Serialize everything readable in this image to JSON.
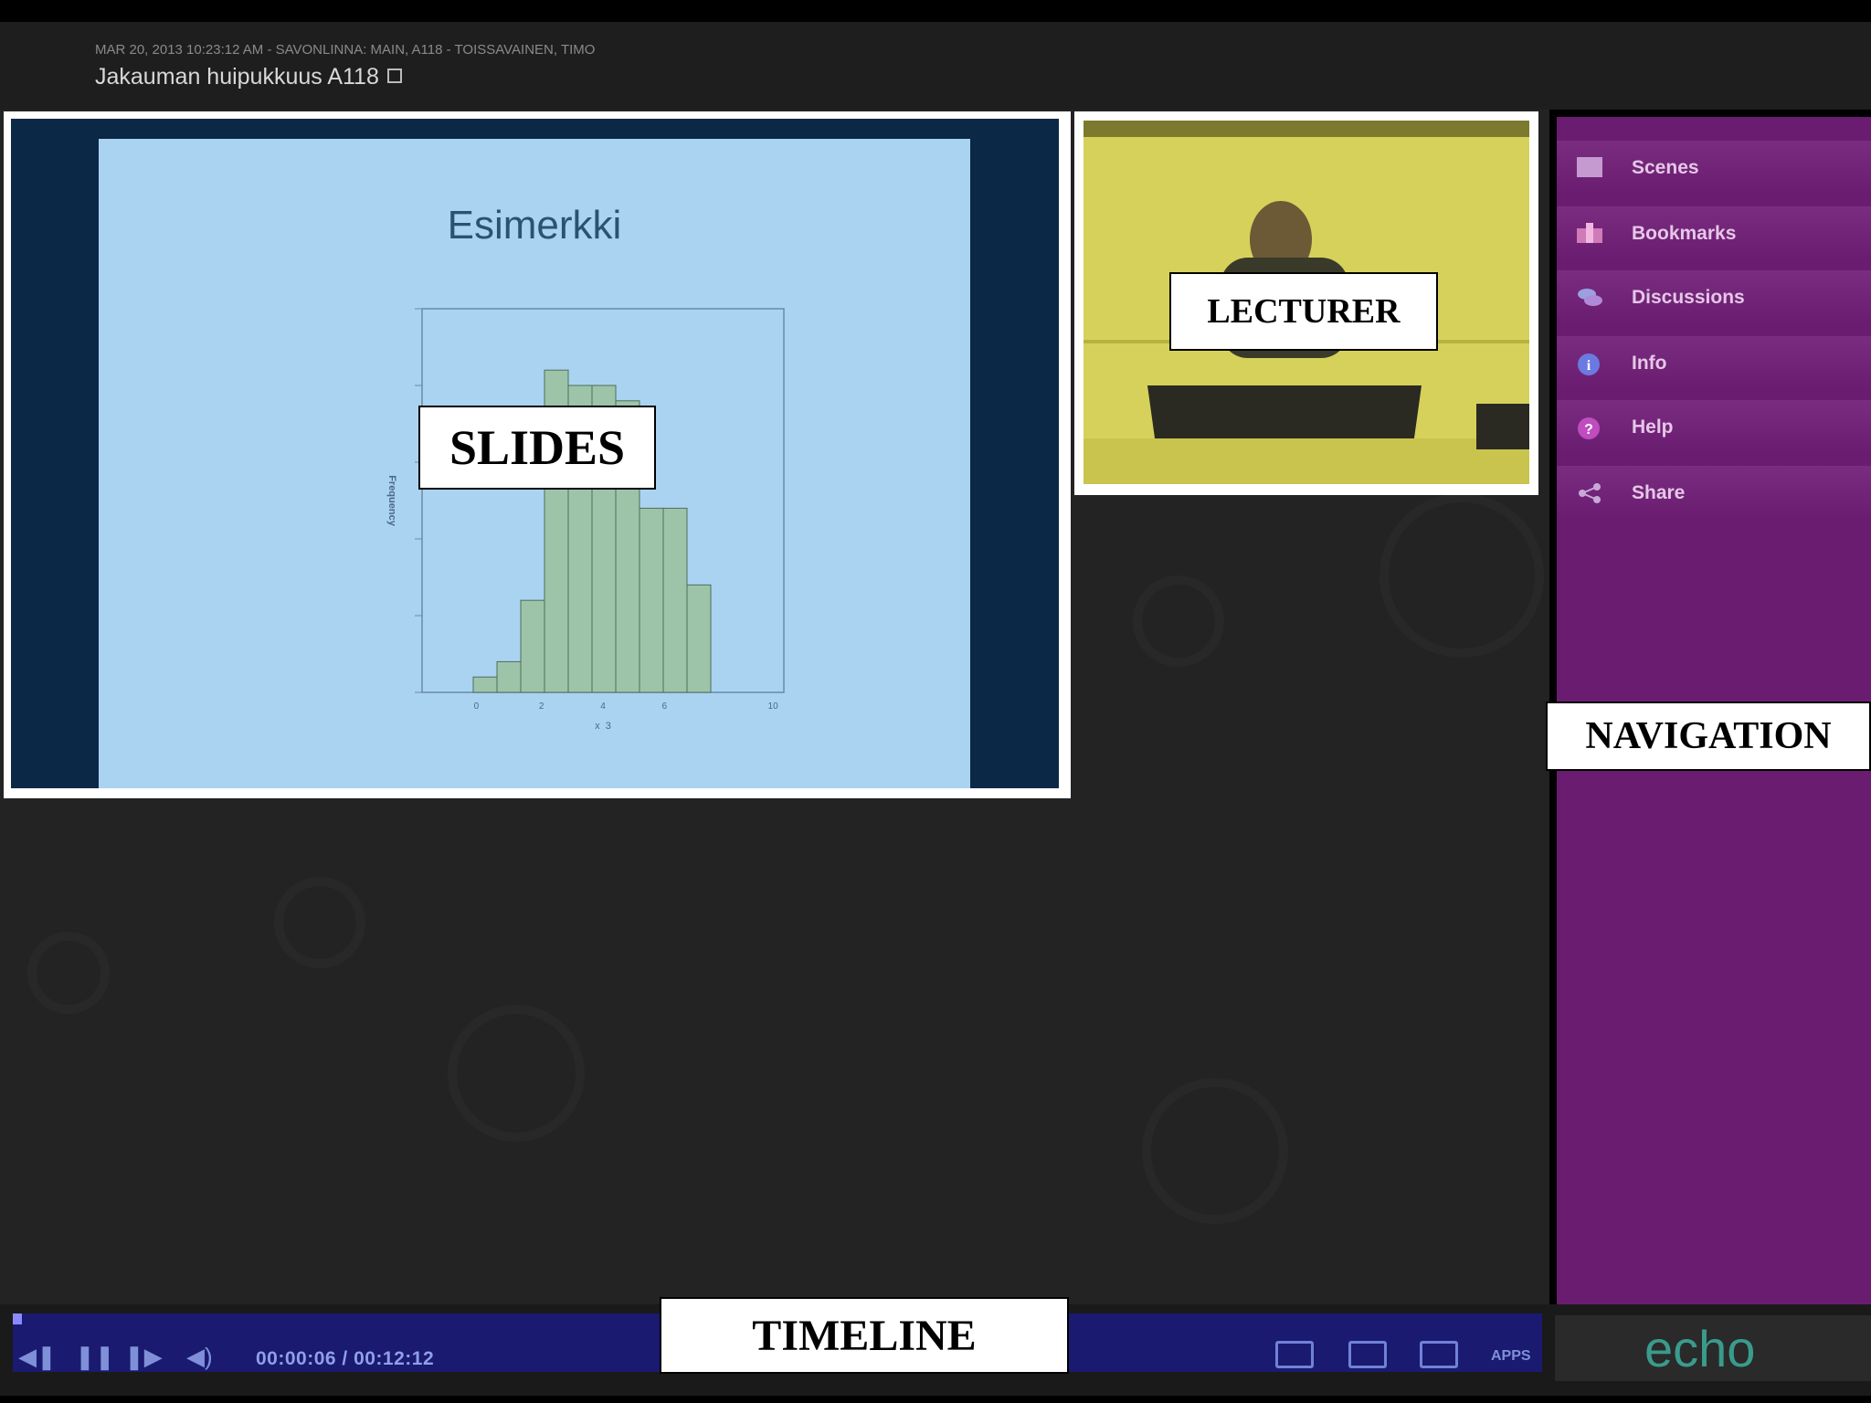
{
  "header": {
    "meta": "MAR 20, 2013 10:23:12 AM - SAVONLINNA: MAIN, A118 - TOISSAVAINEN, TIMO",
    "title": "Jakauman huipukkuus A118"
  },
  "slide": {
    "title": "Esimerkki",
    "chart_data": {
      "type": "bar",
      "ylabel": "Frequency",
      "xlabel": "x_3",
      "xticks": [
        "0",
        "2",
        "4",
        "6",
        "10"
      ],
      "values": [
        2,
        4,
        12,
        42,
        40,
        40,
        38,
        24,
        24,
        14
      ],
      "ylim": [
        0,
        50
      ]
    }
  },
  "navigation": {
    "items": [
      {
        "label": "Scenes",
        "icon": "scenes-icon"
      },
      {
        "label": "Bookmarks",
        "icon": "bookmarks-icon"
      },
      {
        "label": "Discussions",
        "icon": "discussions-icon"
      },
      {
        "label": "Info",
        "icon": "info-icon"
      },
      {
        "label": "Help",
        "icon": "help-icon"
      },
      {
        "label": "Share",
        "icon": "share-icon"
      }
    ]
  },
  "timeline": {
    "time": "00:00:06 / 00:12:12",
    "apps_label": "APPS",
    "progress": 0.008
  },
  "brand": {
    "logo": "echo"
  },
  "callouts": {
    "slides": "SLIDES",
    "lecturer": "LECTURER",
    "navigation": "NAVIGATION",
    "timeline": "TIMELINE"
  },
  "colors": {
    "nav_bg": "#6a1d70",
    "timeline_bg": "#1a1a70",
    "slide_bg": "#a9d3f1",
    "logo": "#3a9b8c"
  }
}
